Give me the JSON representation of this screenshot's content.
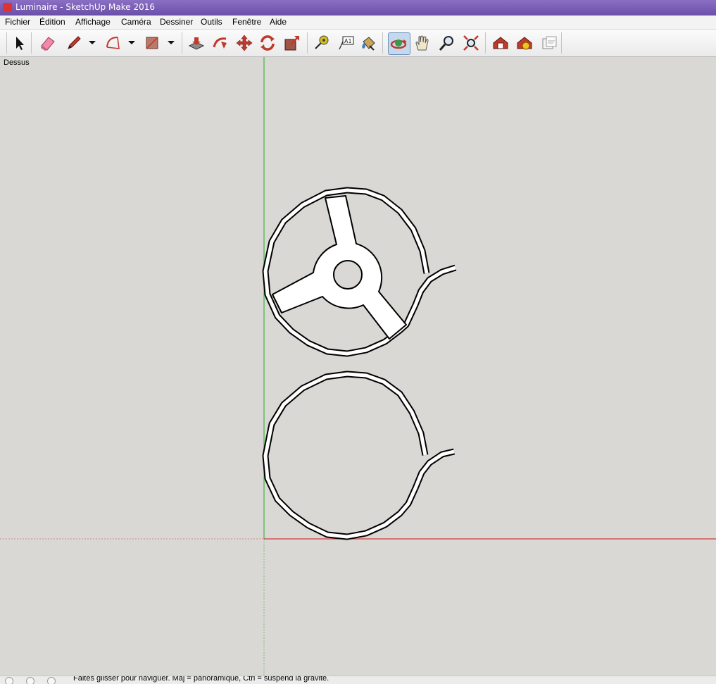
{
  "window": {
    "title": "Luminaire - SketchUp Make 2016"
  },
  "menu": [
    "Fichier",
    "Édition",
    "Affichage",
    "Caméra",
    "Dessiner",
    "Outils",
    "Fenêtre",
    "Aide"
  ],
  "toolbar": {
    "tools": [
      "select-icon",
      "eraser-icon",
      "pencil-icon",
      "arc-icon",
      "rectangle-icon",
      "push-pull-icon",
      "follow-me-icon",
      "move-icon",
      "rotate-icon",
      "scale-icon",
      "tape-measure-icon",
      "text-icon",
      "paint-bucket-icon",
      "orbit-icon",
      "pan-icon",
      "zoom-icon",
      "zoom-extents-icon",
      "warehouse-icon",
      "extension-icon",
      "layout-icon"
    ],
    "active_tool": "orbit-icon"
  },
  "viewport": {
    "view_label": "Dessus"
  },
  "colors": {
    "green_axis": "#3fb63f",
    "red_axis": "#d23b3b",
    "background": "#d9d8d4",
    "accent": "#6a4fa8"
  },
  "status": {
    "message": "Faites glisser pour naviguer. Maj = panoramique, Ctrl = suspend la gravité."
  }
}
